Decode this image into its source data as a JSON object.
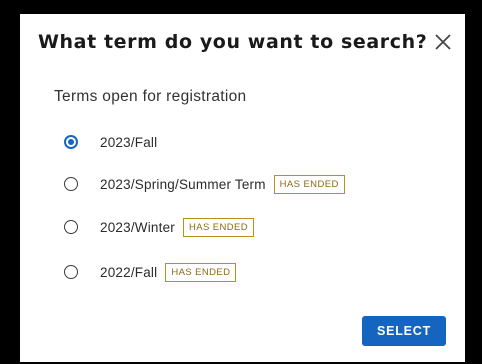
{
  "dialog": {
    "title": "What term do you want to search?",
    "close_icon": "close-icon"
  },
  "terms": {
    "section_label": "Terms open for registration",
    "options": [
      {
        "label": "2023/Fall",
        "selected": true,
        "badge": ""
      },
      {
        "label": "2023/Spring/Summer Term",
        "selected": false,
        "badge": "HAS ENDED"
      },
      {
        "label": "2023/Winter",
        "selected": false,
        "badge": "HAS ENDED"
      },
      {
        "label": "2022/Fall",
        "selected": false,
        "badge": "HAS ENDED"
      }
    ]
  },
  "actions": {
    "select_label": "SELECT"
  },
  "colors": {
    "accent": "#1565c0",
    "badge_text": "#8a6a14",
    "badge_border": "#b8901f"
  }
}
